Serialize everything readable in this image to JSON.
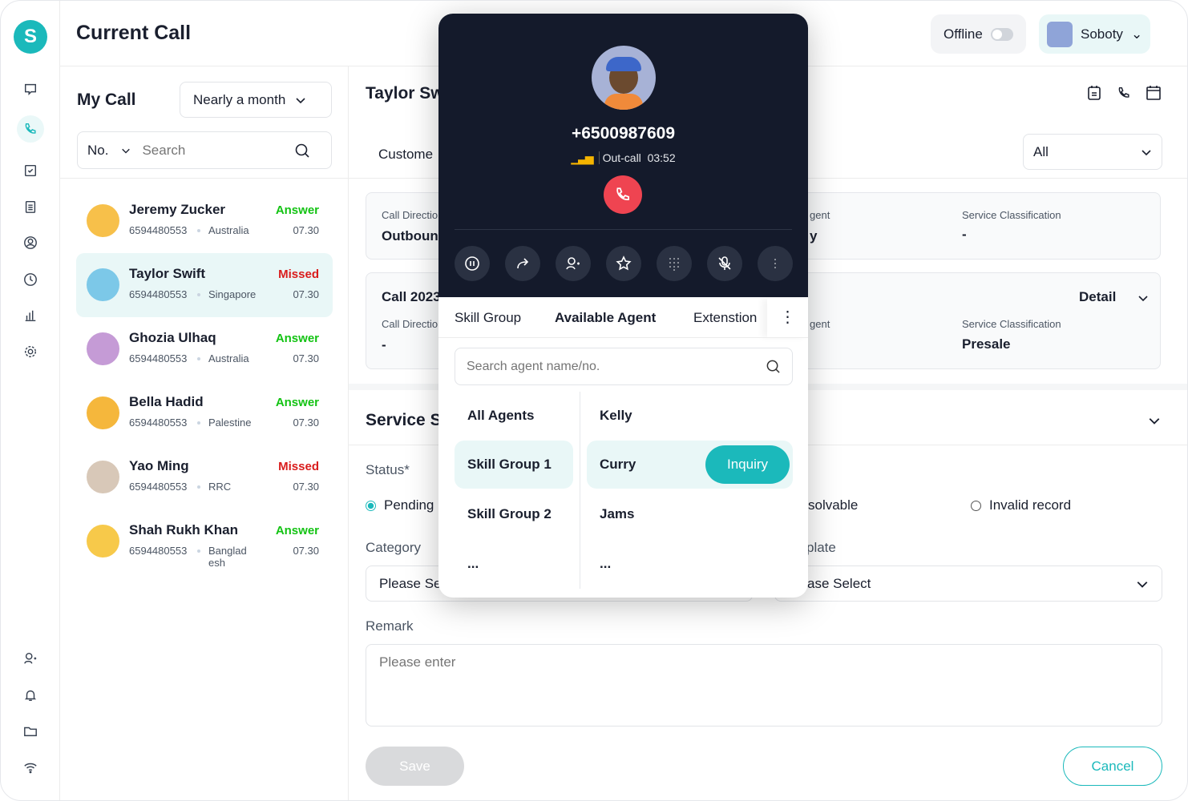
{
  "app": {
    "logo_letter": "S",
    "title": "Current Call"
  },
  "header": {
    "status_label": "Offline",
    "user_name": "Soboty"
  },
  "sidebar": {
    "icons": [
      "chat-icon",
      "phone-icon",
      "checkbox-icon",
      "clipboard-icon",
      "user-circle-icon",
      "clock-icon",
      "chart-icon",
      "gear-icon",
      "user-settings-icon",
      "bell-icon",
      "folder-icon",
      "wifi-icon"
    ]
  },
  "my_call": {
    "title": "My Call",
    "period": "Nearly a month",
    "search_type": "No.",
    "search_placeholder": "Search",
    "calls": [
      {
        "name": "Jeremy Zucker",
        "number": "6594480553",
        "country": "Australia",
        "status": "Answer",
        "time": "07.30",
        "avatar_color": "#f7c04a"
      },
      {
        "name": "Taylor Swift",
        "number": "6594480553",
        "country": "Singapore",
        "status": "Missed",
        "time": "07.30",
        "avatar_color": "#7cc8e8",
        "selected": true
      },
      {
        "name": "Ghozia Ulhaq",
        "number": "6594480553",
        "country": "Australia",
        "status": "Answer",
        "time": "07.30",
        "avatar_color": "#c59bd6"
      },
      {
        "name": "Bella Hadid",
        "number": "6594480553",
        "country": "Palestine",
        "status": "Answer",
        "time": "07.30",
        "avatar_color": "#f5b73c"
      },
      {
        "name": "Yao Ming",
        "number": "6594480553",
        "country": "RRC",
        "status": "Missed",
        "time": "07.30",
        "avatar_color": "#d8c8b8"
      },
      {
        "name": "Shah Rukh Khan",
        "number": "6594480553",
        "country": "Banglad esh",
        "status": "Answer",
        "time": "07.30",
        "avatar_color": "#f7c94a"
      }
    ]
  },
  "colors": {
    "answer": "#13c313",
    "missed": "#d91c1c",
    "accent": "#1bb9bb",
    "end_call": "#ef4451"
  },
  "detail": {
    "name": "Taylor Sw",
    "customer_label": "Custome",
    "filter": "All",
    "card1": {
      "call_direction_label": "Call Directio",
      "call_direction_value": "Outboun",
      "agent_label": "gent",
      "agent_value": "y",
      "service_label": "Service Classification",
      "service_value": "-"
    },
    "card2": {
      "title": "Call 2023",
      "detail_label": "Detail",
      "call_direction_label": "Call Directio",
      "call_direction_value": "-",
      "agent_label": "gent",
      "service_label": "Service Classification",
      "service_value": "Presale"
    }
  },
  "service": {
    "title": "Service S",
    "status_label": "Status*",
    "options": [
      "Pending",
      "solvable",
      "Invalid record"
    ],
    "category_label": "Category",
    "category_value": "Please Se",
    "template_label": "plate",
    "template_value": "ase Select",
    "remark_label": "Remark",
    "remark_placeholder": "Please enter",
    "save": "Save",
    "cancel": "Cancel"
  },
  "phone": {
    "number": "+6500987609",
    "direction": "Out-call",
    "duration": "03:52",
    "controls": [
      "pause-icon",
      "forward-icon",
      "add-user-icon",
      "star-icon",
      "keypad-icon",
      "mute-icon",
      "more-icon"
    ],
    "tabs": [
      "Skill Group",
      "Available Agent",
      "Extenstion"
    ],
    "active_tab": "Available Agent",
    "agent_search_placeholder": "Search agent name/no.",
    "groups": [
      "All Agents",
      "Skill Group 1",
      "Skill Group 2",
      "..."
    ],
    "agents": [
      "Kelly",
      "Curry",
      "Jams",
      "..."
    ],
    "inquiry": "Inquiry"
  }
}
